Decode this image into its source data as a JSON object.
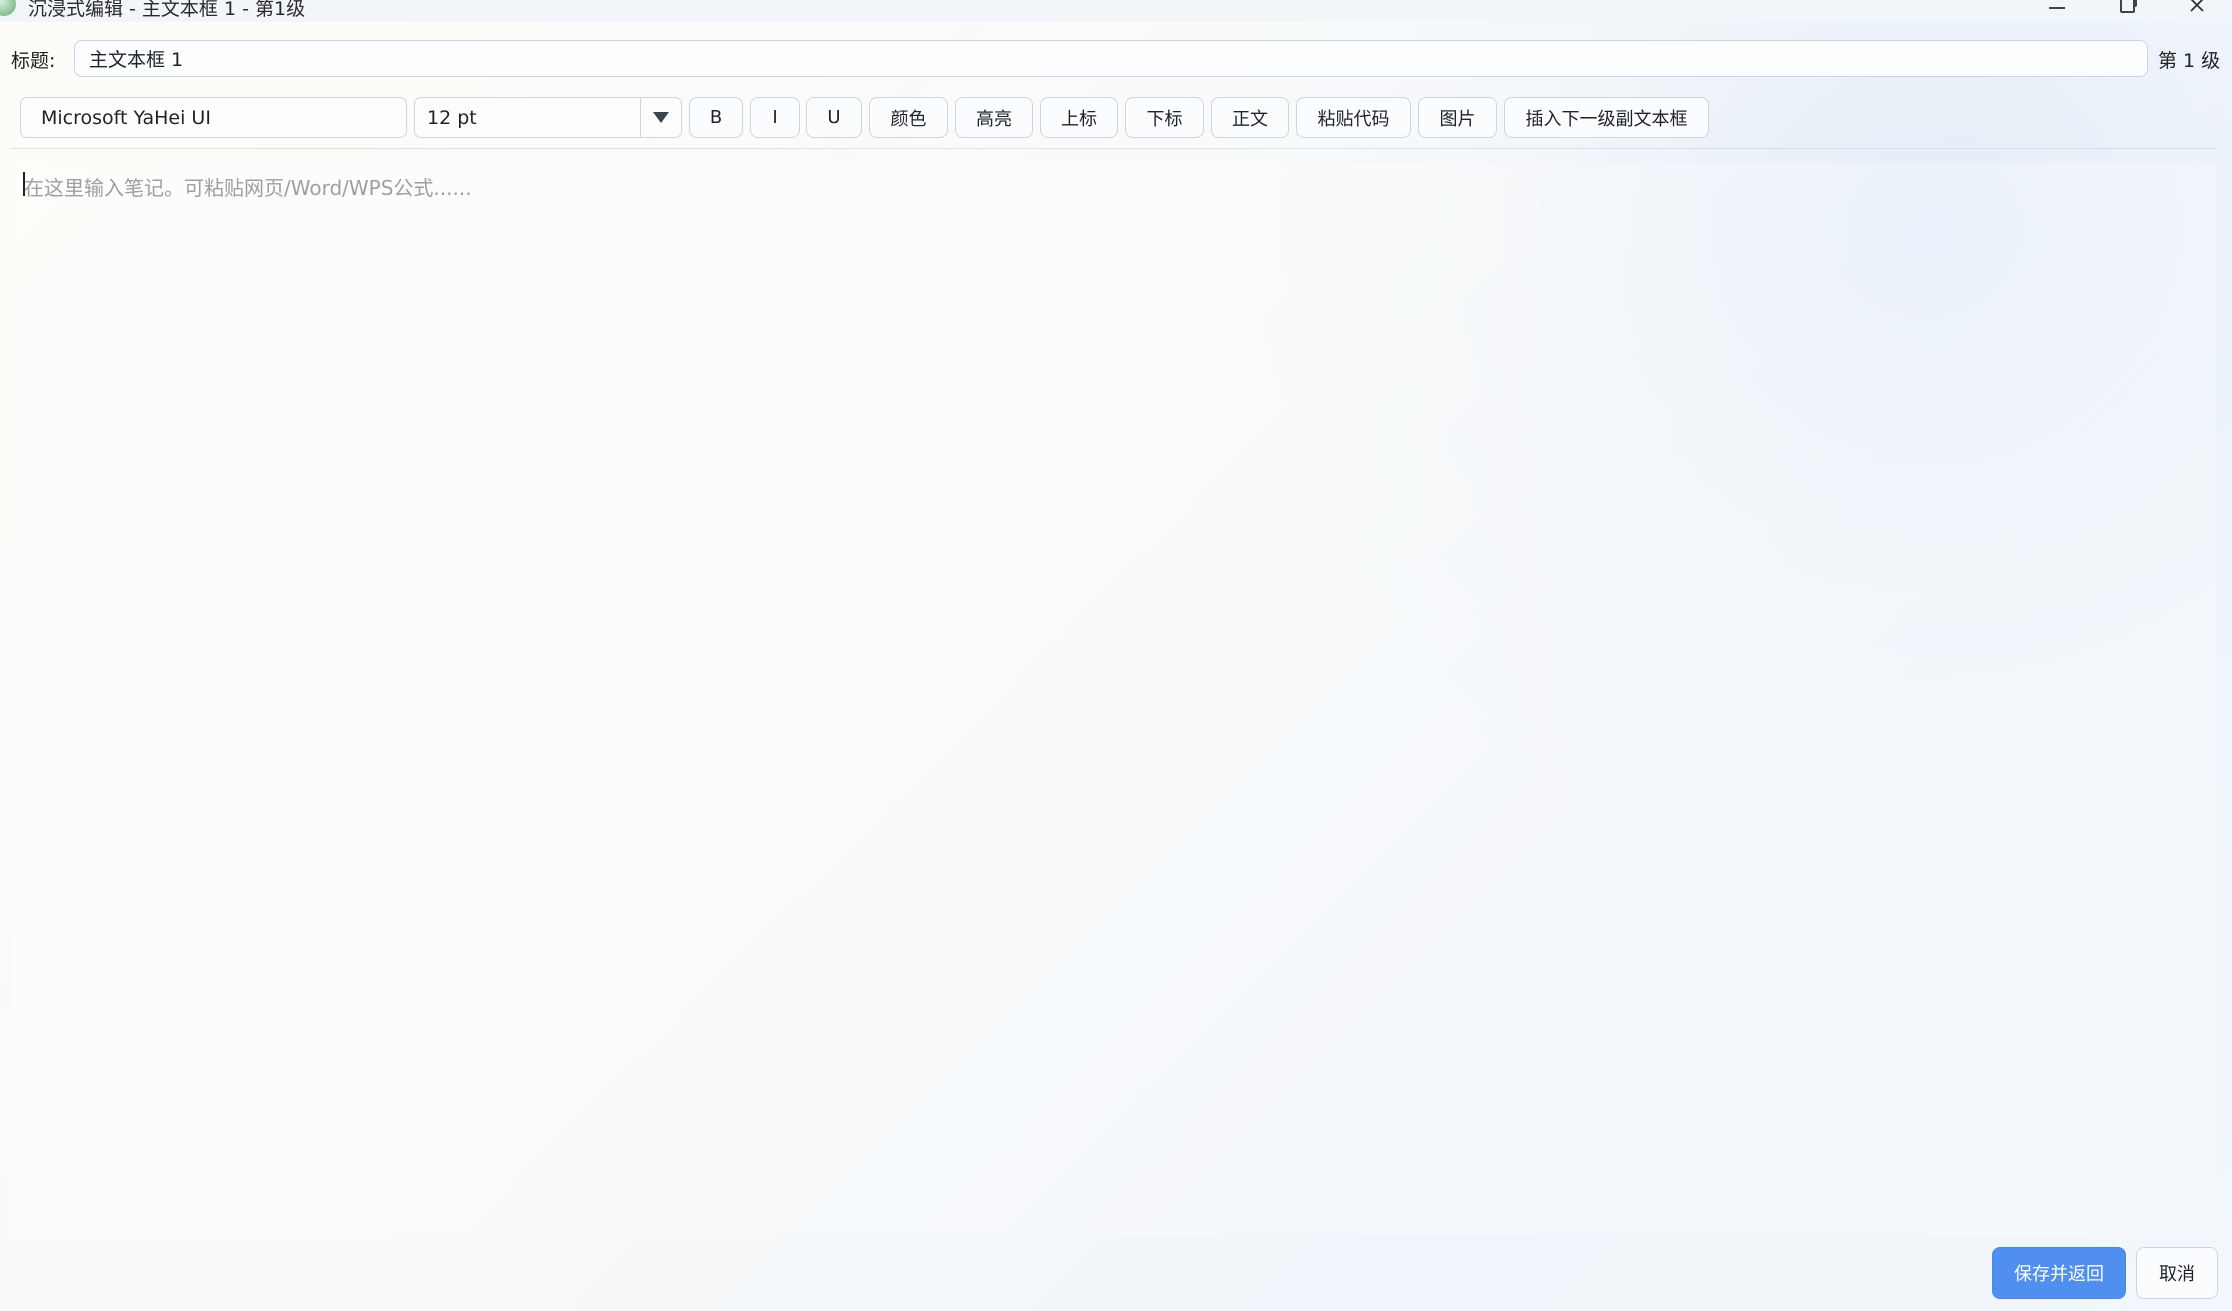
{
  "window": {
    "title": "沉浸式编辑 - 主文本框 1 - 第1级",
    "minimize_icon": "minimize-icon",
    "maximize_icon": "restore-icon",
    "close_icon": "close-icon"
  },
  "header": {
    "title_label": "标题:",
    "title_value": "主文本框 1",
    "level_label": "第 1 级"
  },
  "toolbar": {
    "font_family": "Microsoft YaHei UI",
    "font_size": "12 pt",
    "bold_label": "B",
    "italic_label": "I",
    "underline_label": "U",
    "color_label": "颜色",
    "highlight_label": "高亮",
    "superscript_label": "上标",
    "subscript_label": "下标",
    "normal_label": "正文",
    "paste_code_label": "粘贴代码",
    "image_label": "图片",
    "insert_child_label": "插入下一级副文本框"
  },
  "editor": {
    "placeholder": "在这里输入笔记。可粘贴网页/Word/WPS公式......",
    "content": ""
  },
  "footer": {
    "save_label": "保存并返回",
    "cancel_label": "取消"
  },
  "colors": {
    "accent": "#4e8ff0",
    "border": "#c9d6e4"
  }
}
